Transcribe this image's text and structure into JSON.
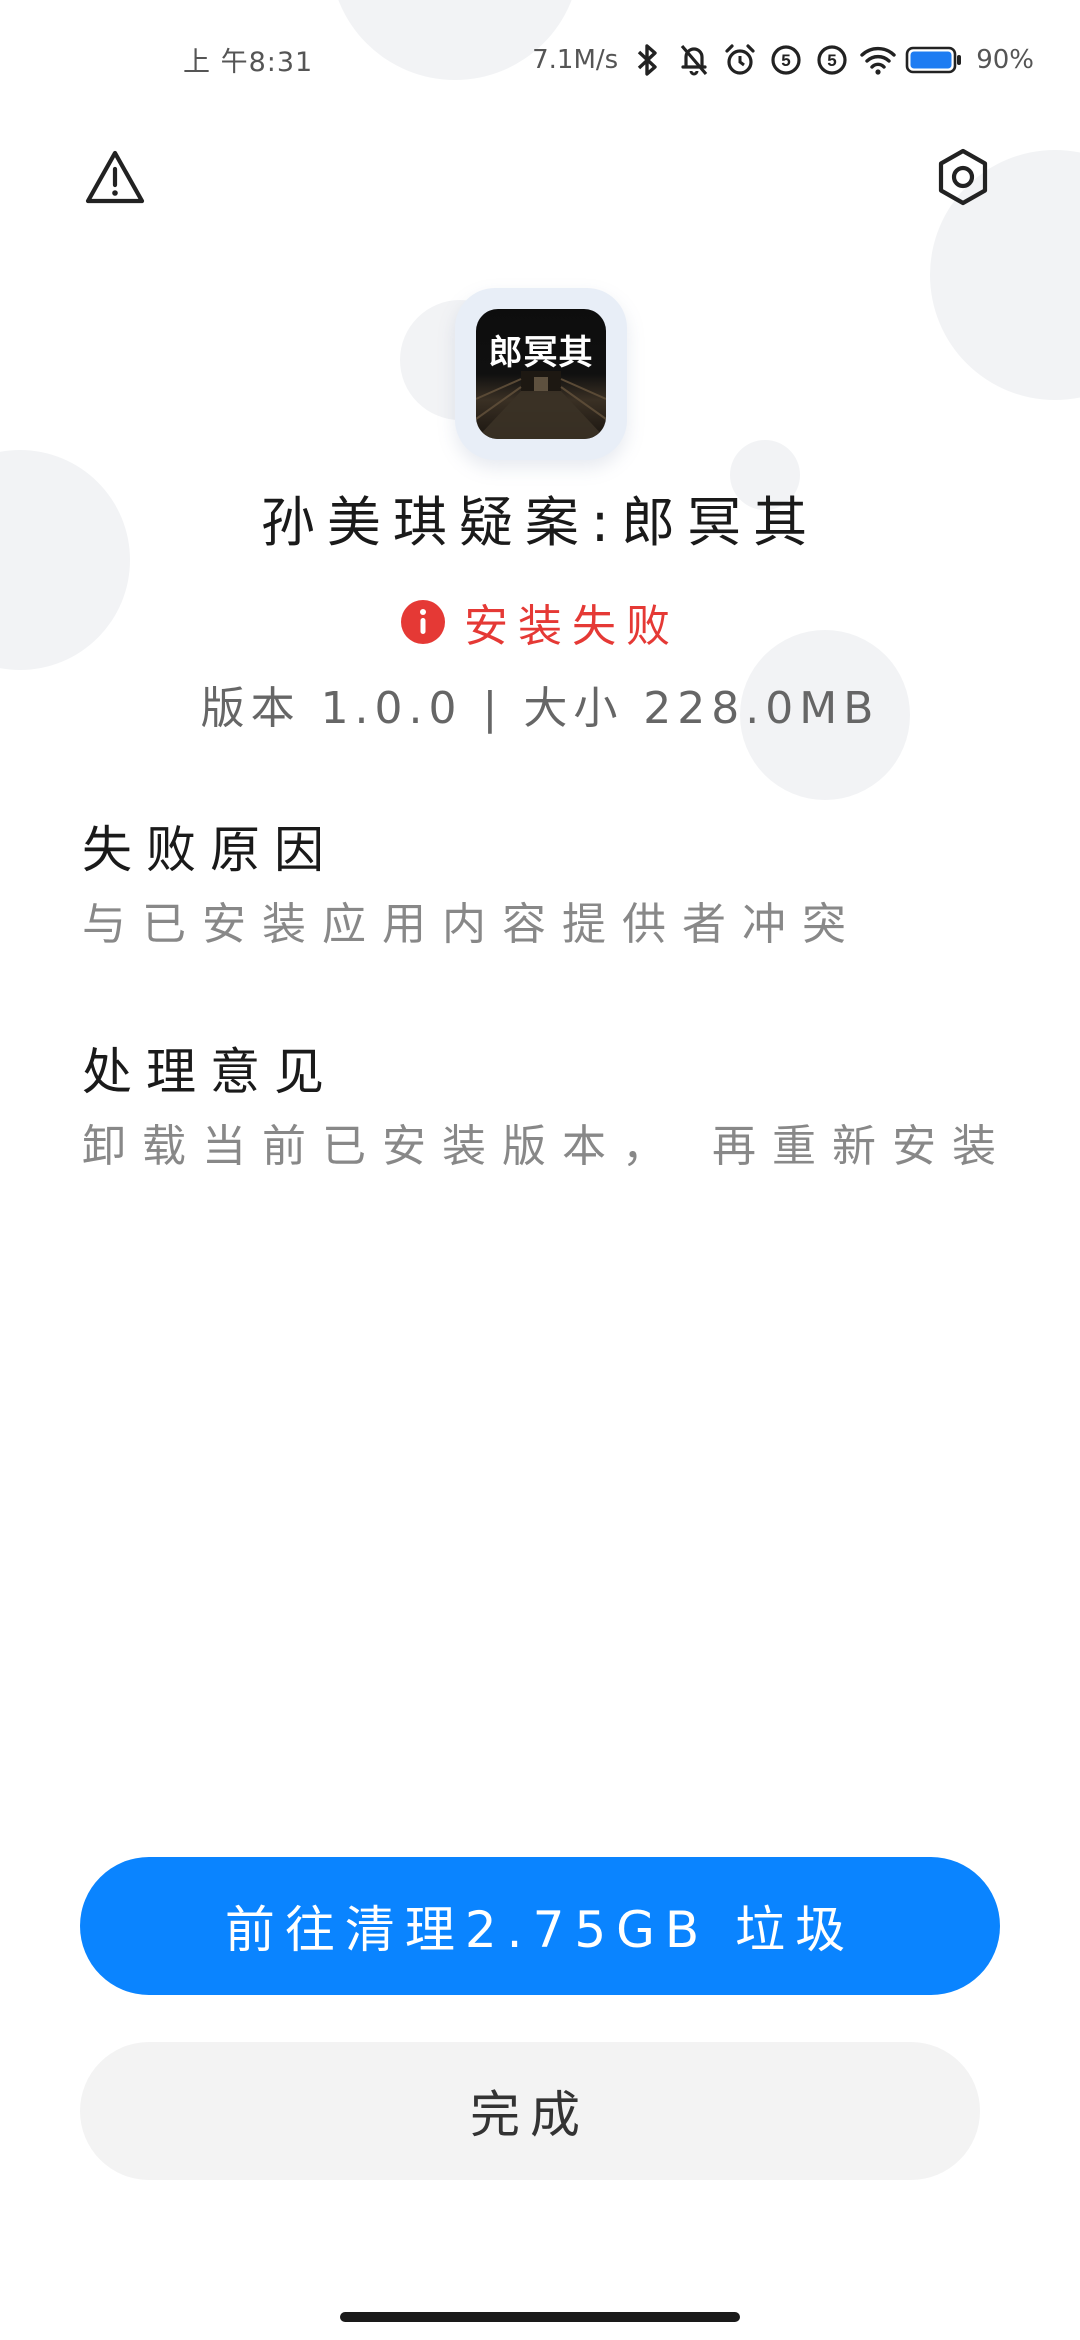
{
  "status_bar": {
    "time": "上 午8:31",
    "net_speed": "7.1M/s",
    "battery_percent": "90%",
    "icons": [
      "bluetooth-icon",
      "mute-bell-icon",
      "alarm-icon",
      "sim-5g-icon",
      "sim-5g-icon",
      "wifi-icon",
      "battery-icon"
    ]
  },
  "top_actions": {
    "left_icon": "warning-icon",
    "right_icon": "settings-icon"
  },
  "app": {
    "icon_text": "郎冥其",
    "name": "孙美琪疑案:郎冥其"
  },
  "install_status": {
    "icon": "info-icon",
    "text": "安装失败",
    "color": "#e53935"
  },
  "meta": "版本 1.0.0 | 大小 228.0MB",
  "sections": {
    "reason": {
      "title": "失败原因",
      "body": "与已安装应用内容提供者冲突"
    },
    "suggestion": {
      "title": "处理意见",
      "body": "卸载当前已安装版本， 再重新安装"
    }
  },
  "buttons": {
    "clean_label": "前往清理2.75GB 垃圾",
    "done_label": "完成"
  },
  "colors": {
    "primary": "#0a84ff",
    "error": "#e53935"
  }
}
